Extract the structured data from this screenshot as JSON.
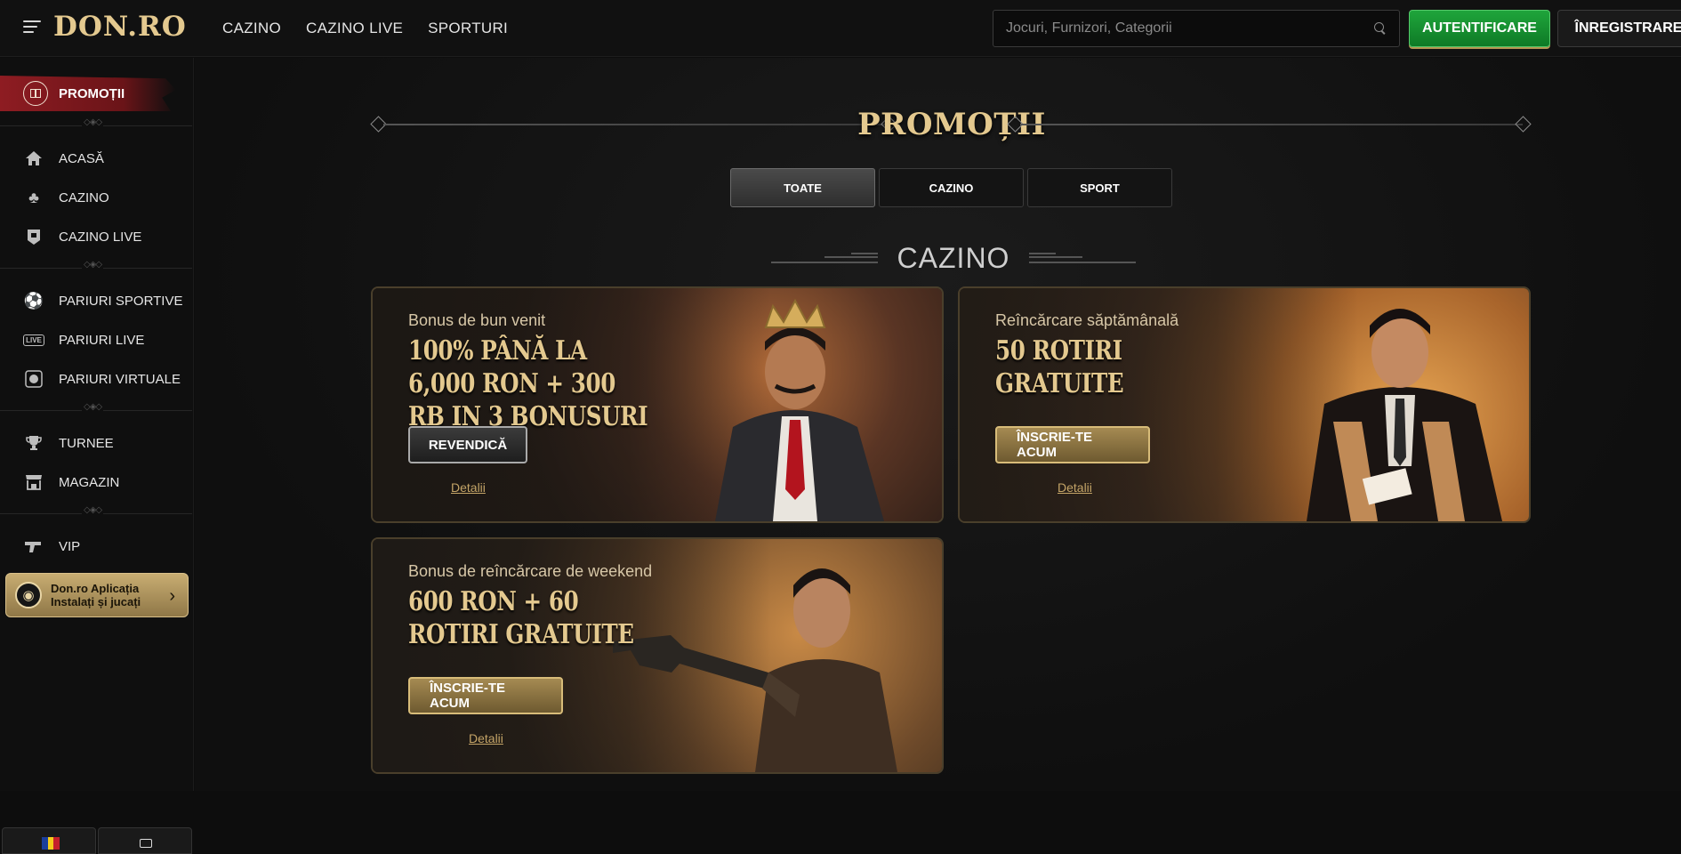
{
  "header": {
    "logo": "DON.RO",
    "nav": [
      "CAZINO",
      "CAZINO LIVE",
      "SPORTURI"
    ],
    "search_placeholder": "Jocuri, Furnizori, Categorii",
    "login_label": "AUTENTIFICARE",
    "register_label": "ÎNREGISTRARE"
  },
  "sidebar": {
    "promo_label": "PROMOȚII",
    "group1": [
      {
        "label": "ACASĂ",
        "icon": "home-icon"
      },
      {
        "label": "CAZINO",
        "icon": "club-icon"
      },
      {
        "label": "CAZINO LIVE",
        "icon": "live-casino-icon"
      }
    ],
    "group2": [
      {
        "label": "PARIURI SPORTIVE",
        "icon": "soccer-ball-icon"
      },
      {
        "label": "PARIURI LIVE",
        "icon": "live-badge-icon",
        "badge": "LIVE"
      },
      {
        "label": "PARIURI VIRTUALE",
        "icon": "virtual-ball-icon"
      }
    ],
    "group3": [
      {
        "label": "TURNEE",
        "icon": "trophy-icon"
      },
      {
        "label": "MAGAZIN",
        "icon": "shop-icon"
      }
    ],
    "group4": [
      {
        "label": "VIP",
        "icon": "vip-gun-icon"
      }
    ],
    "app_banner": {
      "line1": "Don.ro Aplicația",
      "line2": "Instalați și jucați"
    }
  },
  "main": {
    "page_title": "PROMOȚII",
    "filters": [
      {
        "label": "TOATE",
        "active": true
      },
      {
        "label": "CAZINO",
        "active": false
      },
      {
        "label": "SPORT",
        "active": false
      }
    ],
    "section_title": "CAZINO",
    "cards": [
      {
        "subtitle": "Bonus de bun venit",
        "headline": "100%  PÂNĂ LA  6,000 RON  + 300 RB IN 3 BONUSURI",
        "cta": "REVENDICĂ",
        "details": "Detalii"
      },
      {
        "subtitle": "Reîncărcare săptămânală",
        "headline": "50 ROTIRI GRATUITE",
        "cta": "ÎNSCRIE-TE ACUM",
        "details": "Detalii"
      },
      {
        "subtitle": "Bonus de reîncărcare de weekend",
        "headline": "600 RON  + 60 ROTIRI GRATUITE",
        "cta": "ÎNSCRIE-TE ACUM",
        "details": "Detalii"
      }
    ]
  },
  "colors": {
    "gold": "#e4c98f",
    "green": "#1fa53b",
    "promo_red": "#8e1c22",
    "background": "#0d0d0d"
  }
}
